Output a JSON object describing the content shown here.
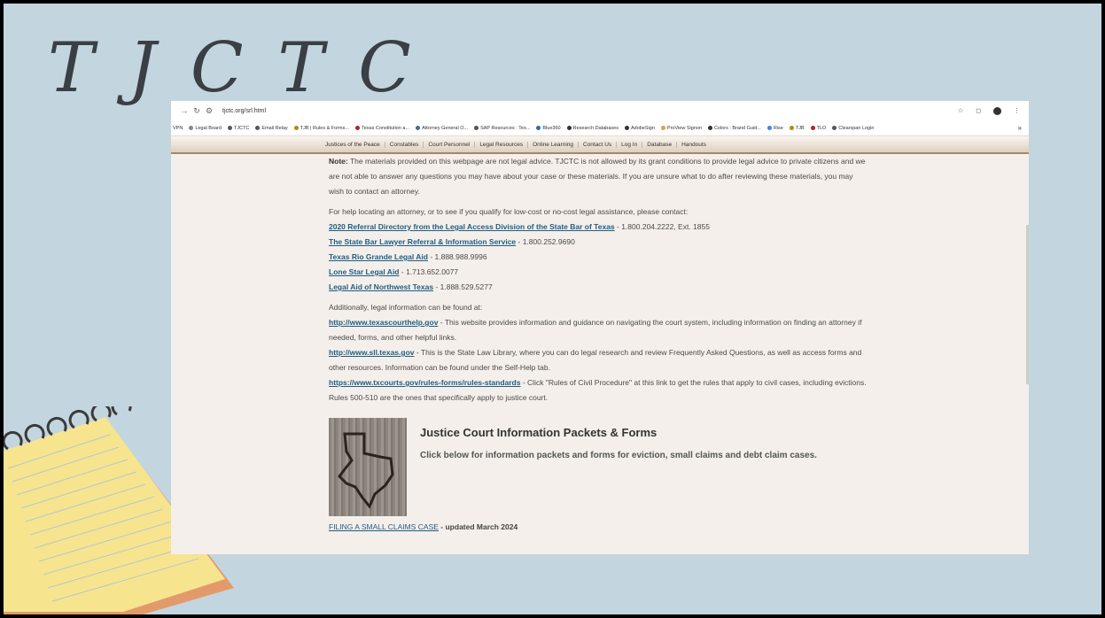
{
  "slide": {
    "title": "T J C T C"
  },
  "browser": {
    "url": "tjctc.org/srl.html",
    "bookmarks": [
      "VPN",
      "Legal Board",
      "TJCTC",
      "Email Relay",
      "TJB | Rules & Forms...",
      "Texas Constitution a...",
      "Attorney General O...",
      "SAP Resources : Tex...",
      "Blue360",
      "Research Databases",
      "AdobeSign",
      "ProView Signon",
      "Colors : Brand Guid...",
      "Rise",
      "TJB",
      "TLO",
      "Clearspan Login"
    ],
    "more_bookmarks": "»"
  },
  "site_nav": [
    "Justices of the Peace",
    "Constables",
    "Court Personnel",
    "Legal Resources",
    "Online Learning",
    "Contact Us",
    "Log In",
    "Database",
    "Handouts"
  ],
  "content": {
    "note_label": "Note:",
    "note_text": " The materials provided on this webpage are not legal advice. TJCTC is not allowed by its grant conditions to provide legal advice to private citizens and we are not able to answer any questions you may have about your case or these materials. If you are unsure what to do after reviewing these materials, you may wish to contact an attorney.",
    "help_intro": "For help locating an attorney, or to see if you qualify for low-cost or no-cost legal assistance, please contact:",
    "referrals": [
      {
        "name": "2020 Referral Directory from the Legal Access Division of the State Bar of Texas",
        "phone": " - 1.800.204.2222, Ext. 1855"
      },
      {
        "name": "The State Bar Lawyer Referral & Information Service",
        "phone": " - 1.800.252.9690"
      },
      {
        "name": "Texas Rio Grande Legal Aid",
        "phone": " - 1.888.988.9996"
      },
      {
        "name": "Lone Star Legal Aid",
        "phone": " - 1.713.652.0077"
      },
      {
        "name": "Legal Aid of Northwest Texas",
        "phone": " - 1.888.529.5277"
      }
    ],
    "additional_intro": "Additionally, legal information can be found at:",
    "links": [
      {
        "url": "http://www.texascourthelp.gov",
        "desc": " - This website provides information and guidance on navigating the court system, including information on finding an attorney if needed, forms, and other helpful links."
      },
      {
        "url": "http://www.sll.texas.gov",
        "desc": " - This is the State Law Library, where you can do legal research and review Frequently Asked Questions, as well as access forms and other resources. Information can be found under the Self-Help tab."
      },
      {
        "url": "https://www.txcourts.gov/rules-forms/rules-standards",
        "desc": " - Click \"Rules of Civil Procedure\" at this link to get the rules that apply to civil cases, including evictions. Rules 500-510 are the ones that specifically apply to justice court."
      }
    ],
    "packet_title": "Justice Court Information Packets & Forms",
    "packet_subtitle": "Click below for information packets and forms for eviction, small claims and debt claim cases.",
    "small_claims_link": "FILING A SMALL CLAIMS CASE",
    "small_claims_updated": " - updated March 2024"
  }
}
